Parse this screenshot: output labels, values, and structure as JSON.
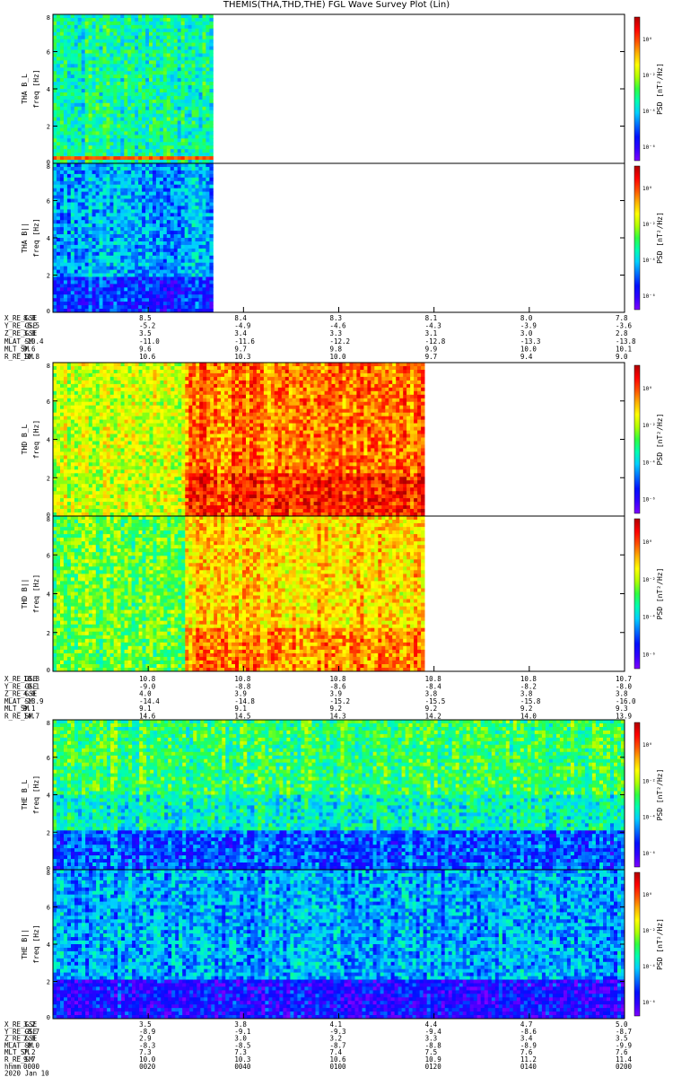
{
  "title": "THEMIS(THA,THD,THE) FGL Wave Survey Plot (Lin)",
  "colors": {
    "frame": "#000000",
    "background": "#ffffff"
  },
  "colorbar_stops": [
    "#7f00ff",
    "#3300ff",
    "#0010ff",
    "#0070ff",
    "#00d0ff",
    "#00ffb0",
    "#30ff40",
    "#b0ff00",
    "#ffff00",
    "#ffb000",
    "#ff5000",
    "#ff0000",
    "#b00000"
  ],
  "chart_data": [
    {
      "type": "heatmap",
      "panels": [
        {
          "name": "THA B_L",
          "ylabel": "THA B_L",
          "yunit": "freq [Hz]",
          "yticks": [
            "0",
            "2",
            "4",
            "6",
            "8"
          ],
          "ylim": [
            0,
            8
          ],
          "cbar_label": "PSD [nT²/Hz]",
          "cbar_ticks": [
            "10⁰",
            "10⁻²",
            "10⁻⁴",
            "10⁻⁶"
          ],
          "data_end_frac": 0.28,
          "mean_level": 0.42,
          "features": "low-frequency band near 0.3 Hz elevated (yellow-red)"
        },
        {
          "name": "THA B||",
          "ylabel": "THA B||",
          "yunit": "freq [Hz]",
          "yticks": [
            "0",
            "2",
            "4",
            "6",
            "8"
          ],
          "ylim": [
            0,
            8
          ],
          "cbar_label": "PSD [nT²/Hz]",
          "cbar_ticks": [
            "10⁰",
            "10⁻²",
            "10⁻⁴",
            "10⁻⁶"
          ],
          "data_end_frac": 0.28,
          "mean_level": 0.3,
          "features": "mostly blue, darker at low frequency"
        }
      ],
      "ephemeris": {
        "labels": [
          "X_RE_GSE",
          "Y_RE_GSE",
          "Z_RE_GSE",
          "MLAT_SM",
          "MLT_SM",
          "R_RE_SM"
        ],
        "columns": [
          [
            "8.8",
            "-5.5",
            "3.8",
            "-10.4",
            "9.6",
            "10.8"
          ],
          [
            "8.5",
            "-5.2",
            "3.5",
            "-11.0",
            "9.6",
            "10.6"
          ],
          [
            "8.4",
            "-4.9",
            "3.4",
            "-11.6",
            "9.7",
            "10.3"
          ],
          [
            "8.3",
            "-4.6",
            "3.3",
            "-12.2",
            "9.8",
            "10.0"
          ],
          [
            "8.1",
            "-4.3",
            "3.1",
            "-12.8",
            "9.9",
            "9.7"
          ],
          [
            "8.0",
            "-3.9",
            "3.0",
            "-13.3",
            "10.0",
            "9.4"
          ],
          [
            "7.8",
            "-3.6",
            "2.8",
            "-13.8",
            "10.1",
            "9.0"
          ]
        ]
      }
    },
    {
      "type": "heatmap",
      "panels": [
        {
          "name": "THD B_L",
          "ylabel": "THD B_L",
          "yunit": "freq [Hz]",
          "yticks": [
            "0",
            "2",
            "4",
            "6",
            "8"
          ],
          "ylim": [
            0,
            8
          ],
          "cbar_label": "PSD [nT²/Hz]",
          "cbar_ticks": [
            "10⁰",
            "10⁻²",
            "10⁻⁴",
            "10⁻⁶"
          ],
          "data_end_frac": 0.65,
          "mean_level": 0.62,
          "features": "enhanced (yellow-red) after ~0018"
        },
        {
          "name": "THD B||",
          "ylabel": "THD B||",
          "yunit": "freq [Hz]",
          "yticks": [
            "0",
            "2",
            "4",
            "6",
            "8"
          ],
          "ylim": [
            0,
            8
          ],
          "cbar_label": "PSD [nT²/Hz]",
          "cbar_ticks": [
            "10⁰",
            "10⁻²",
            "10⁻⁴",
            "10⁻⁶"
          ],
          "data_end_frac": 0.65,
          "mean_level": 0.52,
          "features": "enhanced (yellow-orange) after ~0018"
        }
      ],
      "ephemeris": {
        "labels": [
          "X_RE_GSE",
          "Y_RE_GSE",
          "Z_RE_GSE",
          "MLAT_SM",
          "MLT_SM",
          "R_RE_SM"
        ],
        "columns": [
          [
            "10.8",
            "-9.1",
            "4.0",
            "-13.9",
            "9.1",
            "14.7"
          ],
          [
            "10.8",
            "-9.0",
            "4.0",
            "-14.4",
            "9.1",
            "14.6"
          ],
          [
            "10.8",
            "-8.8",
            "3.9",
            "-14.8",
            "9.1",
            "14.5"
          ],
          [
            "10.8",
            "-8.6",
            "3.9",
            "-15.2",
            "9.2",
            "14.3"
          ],
          [
            "10.8",
            "-8.4",
            "3.8",
            "-15.5",
            "9.2",
            "14.2"
          ],
          [
            "10.8",
            "-8.2",
            "3.8",
            "-15.8",
            "9.2",
            "14.0"
          ],
          [
            "10.7",
            "-8.0",
            "3.8",
            "-16.0",
            "9.3",
            "13.9"
          ]
        ]
      }
    },
    {
      "type": "heatmap",
      "panels": [
        {
          "name": "THE B_L",
          "ylabel": "THE B_L",
          "yunit": "freq [Hz]",
          "yticks": [
            "0",
            "2",
            "4",
            "6",
            "8"
          ],
          "ylim": [
            0,
            8
          ],
          "cbar_label": "PSD [nT²/Hz]",
          "cbar_ticks": [
            "10⁰",
            "10⁻²",
            "10⁻⁴",
            "10⁻⁶"
          ],
          "data_end_frac": 1.0,
          "mean_level": 0.4,
          "features": "green at high frequency, dark blue bands below 1 Hz"
        },
        {
          "name": "THE B||",
          "ylabel": "THE B||",
          "yunit": "freq [Hz]",
          "yticks": [
            "0",
            "2",
            "4",
            "6",
            "8"
          ],
          "ylim": [
            0,
            8
          ],
          "cbar_label": "PSD [nT²/Hz]",
          "cbar_ticks": [
            "10⁰",
            "10⁻²",
            "10⁻⁴",
            "10⁻⁶"
          ],
          "data_end_frac": 1.0,
          "mean_level": 0.3,
          "features": "cyan-blue throughout, darker at low frequency"
        }
      ],
      "ephemeris": {
        "labels": [
          "X_RE_GSE",
          "Y_RE_GSE",
          "Z_RE_GSE",
          "MLAT_SM",
          "MLT_SM",
          "R_RE_SM",
          "hhmm"
        ],
        "columns": [
          [
            "3.2",
            "-8.7",
            "2.8",
            "-8.0",
            "7.2",
            "9.7",
            "0000"
          ],
          [
            "3.5",
            "-8.9",
            "2.9",
            "-8.3",
            "7.3",
            "10.0",
            "0020"
          ],
          [
            "3.8",
            "-9.1",
            "3.0",
            "-8.5",
            "7.3",
            "10.3",
            "0040"
          ],
          [
            "4.1",
            "-9.3",
            "3.2",
            "-8.7",
            "7.4",
            "10.6",
            "0100"
          ],
          [
            "4.4",
            "-9.4",
            "3.3",
            "-8.8",
            "7.5",
            "10.9",
            "0120"
          ],
          [
            "4.7",
            "-8.6",
            "3.4",
            "-8.9",
            "7.6",
            "11.2",
            "0140"
          ],
          [
            "5.0",
            "-8.7",
            "3.5",
            "-9.9",
            "7.6",
            "11.4",
            "0200"
          ]
        ],
        "date": "2020 Jan 10"
      }
    }
  ]
}
